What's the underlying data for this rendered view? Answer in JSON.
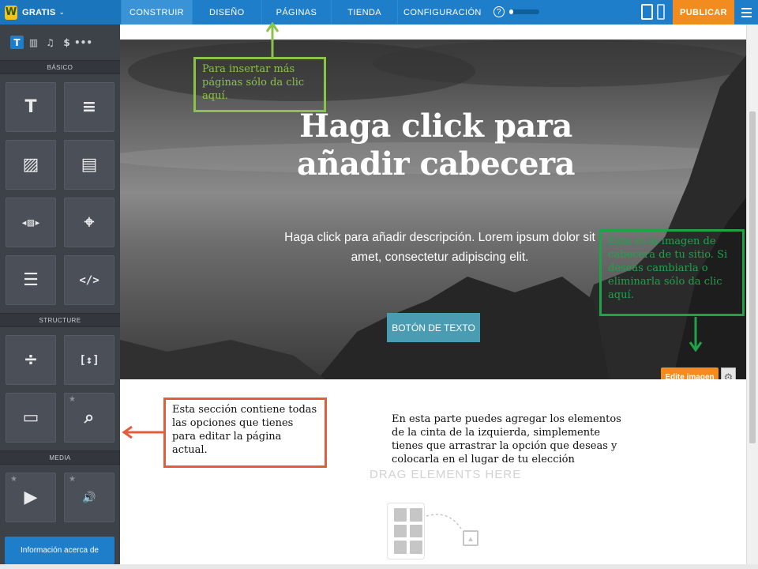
{
  "topbar": {
    "logo_letter": "W",
    "plan_label": "GRATIS",
    "plan_caret": "⌄",
    "tabs": [
      {
        "label": "CONSTRUIR",
        "active": true
      },
      {
        "label": "DISEÑO",
        "active": false
      },
      {
        "label": "PÁGINAS",
        "active": false
      },
      {
        "label": "TIENDA",
        "active": false
      },
      {
        "label": "CONFIGURACIÓN",
        "active": false
      }
    ],
    "help_label": "?",
    "progress_fraction": 0.15,
    "publish_label": "PUBLICAR",
    "colors": {
      "bar": "#1f7ec9",
      "publish": "#f28c1f"
    }
  },
  "sidebar": {
    "tabs": [
      {
        "glyph": "T",
        "icon": "text-icon",
        "active": true
      },
      {
        "glyph": "▥",
        "icon": "layout-icon",
        "active": false
      },
      {
        "glyph": "♫",
        "icon": "music-icon",
        "active": false
      },
      {
        "glyph": "$",
        "icon": "dollar-icon",
        "active": false
      },
      {
        "glyph": "•••",
        "icon": "more-icon",
        "active": false
      }
    ],
    "sections": [
      {
        "title": "BÁSICO",
        "tiles": [
          {
            "glyph": "T",
            "icon": "title-icon",
            "star": false
          },
          {
            "glyph": "≡",
            "icon": "paragraph-icon",
            "star": false
          },
          {
            "glyph": "▨",
            "icon": "image-icon",
            "star": false
          },
          {
            "glyph": "▤",
            "icon": "image-text-icon",
            "star": false
          },
          {
            "glyph": "◂▨▸",
            "icon": "gallery-icon",
            "star": false
          },
          {
            "glyph": "⌖",
            "icon": "map-icon",
            "star": false
          },
          {
            "glyph": "☰",
            "icon": "form-icon",
            "star": false
          },
          {
            "glyph": "</>",
            "icon": "embed-code-icon",
            "star": false
          }
        ]
      },
      {
        "title": "STRUCTURE",
        "tiles": [
          {
            "glyph": "÷",
            "icon": "divider-icon",
            "star": false
          },
          {
            "glyph": "[↕]",
            "icon": "spacer-icon",
            "star": false
          },
          {
            "glyph": "▭",
            "icon": "button-icon",
            "star": false
          },
          {
            "glyph": "⌕",
            "icon": "search-box-icon",
            "star": true
          }
        ]
      },
      {
        "title": "MEDIA",
        "tiles": [
          {
            "glyph": "▶",
            "icon": "video-icon",
            "star": true
          },
          {
            "glyph": "🔊",
            "icon": "audio-icon",
            "star": true
          }
        ]
      }
    ],
    "info_button_label": "Información acerca de"
  },
  "main": {
    "hero": {
      "title": "Haga click para añadir cabecera",
      "description": "Haga click para añadir descripción. Lorem ipsum dolor sit amet, consectetur adipiscing elit.",
      "button_label": "BOTÓN DE TEXTO",
      "edit_image_label": "Edite imagen",
      "gear_glyph": "⚙"
    },
    "drag_label": "DRAG ELEMENTS HERE"
  },
  "annotations": {
    "pages_note": "Para insertar más páginas sólo da clic aquí.",
    "header_note": "Esta es la imagen de cabecera de tu sitio. Si deseas cambiarla o eliminarla sólo da clic aquí.",
    "section_note": "Esta sección contiene todas las opciones que tienes para editar la página actual.",
    "elements_note": "En esta parte puedes agregar los elementos de la cinta de la izquierda, simplemente tienes que arrastrar  la opción que deseas y colocarla en el lugar de tu elección",
    "colors": {
      "pages": "#8bc34a",
      "header": "#1fa24a",
      "section": "#e35d3d"
    }
  }
}
